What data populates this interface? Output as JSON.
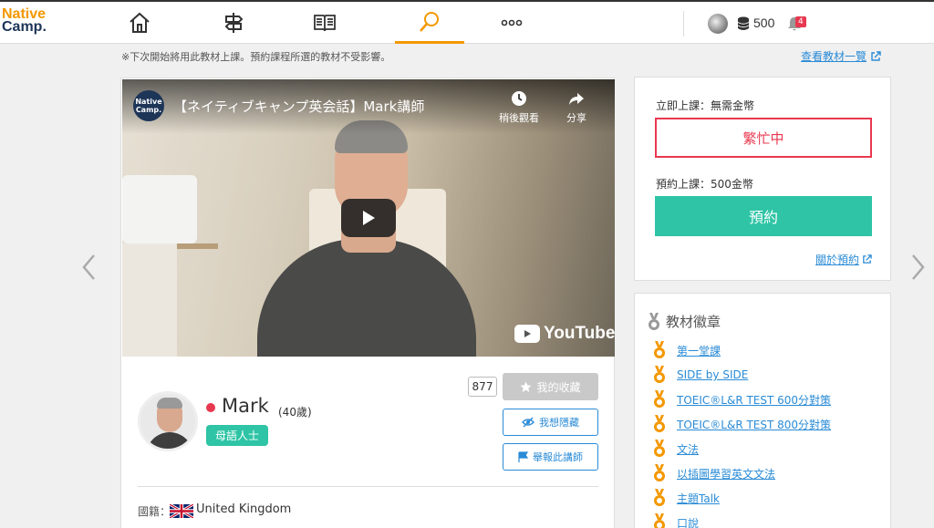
{
  "logo": {
    "line1": "Native",
    "line2": "Camp."
  },
  "header": {
    "coins": "500",
    "notifications": "4"
  },
  "notice": "※下次開始將用此教材上課。預約課程所選的教材不受影響。",
  "catalog_link": "查看教材一覽",
  "video": {
    "channel_logo": "Native Camp.",
    "title": "【ネイティブキャンプ英会話】Mark講師",
    "watch_later": "稍後觀看",
    "share": "分享",
    "youtube": "YouTube"
  },
  "teacher": {
    "name": "Mark",
    "age": "(40歲)",
    "native_badge": "母語人士",
    "favorites_count": "877",
    "favorite_label": "我的收藏",
    "hide_label": "我想隱藏",
    "report_label": "舉報此講師",
    "nationality_label": "國籍：",
    "nationality": "United Kingdom"
  },
  "booking": {
    "instant_label": "立即上課：無需金幣",
    "busy_label": "繁忙中",
    "reserve_price_label": "預約上課：500金幣",
    "reserve_button": "預約",
    "about_link": "關於預約"
  },
  "badges": {
    "title": "教材徽章",
    "items": [
      "第一堂課",
      "SIDE by SIDE",
      "TOEIC®L&R TEST 600分對策",
      "TOEIC®L&R TEST 800分對策",
      "文法",
      "以插圖學習英文文法",
      "主題Talk",
      "口說"
    ]
  },
  "colors": {
    "accent": "#f39800",
    "teal": "#2ec4a5",
    "red": "#e8384f",
    "link": "#2a8bd6"
  }
}
